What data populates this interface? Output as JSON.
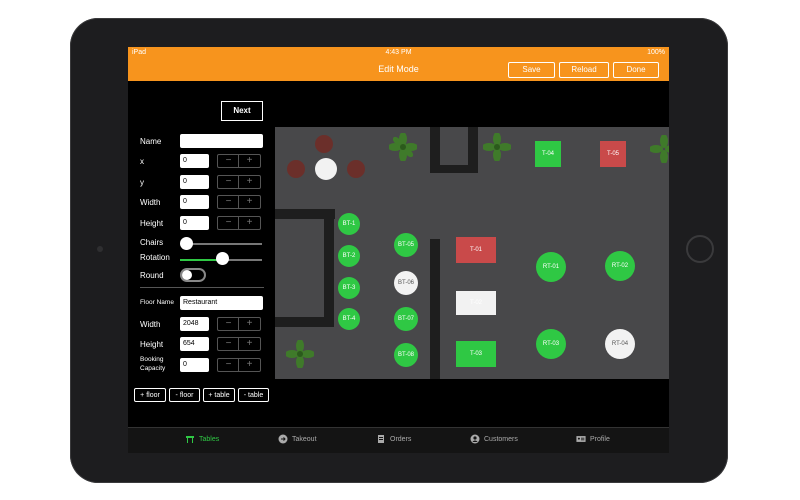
{
  "status_bar": {
    "carrier": "iPad",
    "time": "4:43 PM",
    "battery": "100%"
  },
  "nav": {
    "title": "Edit Mode",
    "save": "Save",
    "reload": "Reload",
    "done": "Done"
  },
  "editor": {
    "next": "Next",
    "name_label": "Name",
    "name_value": "",
    "x_label": "x",
    "x_value": "0",
    "y_label": "y",
    "y_value": "0",
    "width_label": "Width",
    "width_value": "0",
    "height_label": "Height",
    "height_value": "0",
    "chairs_label": "Chairs",
    "rotation_label": "Rotation",
    "round_label": "Round",
    "floor_name_label": "Floor Name",
    "floor_name_value": "Restaurant",
    "floor_width_label": "Width",
    "floor_width_value": "2048",
    "floor_height_label": "Height",
    "floor_height_value": "654",
    "booking_label_1": "Booking",
    "booking_label_2": "Capacity",
    "booking_value": "0",
    "stepper_minus": "−",
    "stepper_plus": "+",
    "buttons": [
      "+ floor",
      "- floor",
      "+ table",
      "- table"
    ]
  },
  "floor_tables": {
    "bar": [
      "BT-1",
      "BT-2",
      "BT-3",
      "BT-4"
    ],
    "bar2": [
      "BT-05",
      "BT-06",
      "BT-07",
      "BT-08"
    ],
    "rect": [
      "T-01",
      "T-02",
      "T-03"
    ],
    "top": [
      "T-04",
      "T-05"
    ],
    "round": [
      "RT-01",
      "RT-02",
      "RT-03",
      "RT-04"
    ]
  },
  "tabs": [
    {
      "label": "Tables",
      "icon": "tables-icon"
    },
    {
      "label": "Takeout",
      "icon": "takeout-icon"
    },
    {
      "label": "Orders",
      "icon": "orders-icon"
    },
    {
      "label": "Customers",
      "icon": "customers-icon"
    },
    {
      "label": "Profile",
      "icon": "profile-icon"
    }
  ],
  "colors": {
    "accent": "#f7941d",
    "active_tab": "#2fc844",
    "occupied": "#c94a4a"
  }
}
